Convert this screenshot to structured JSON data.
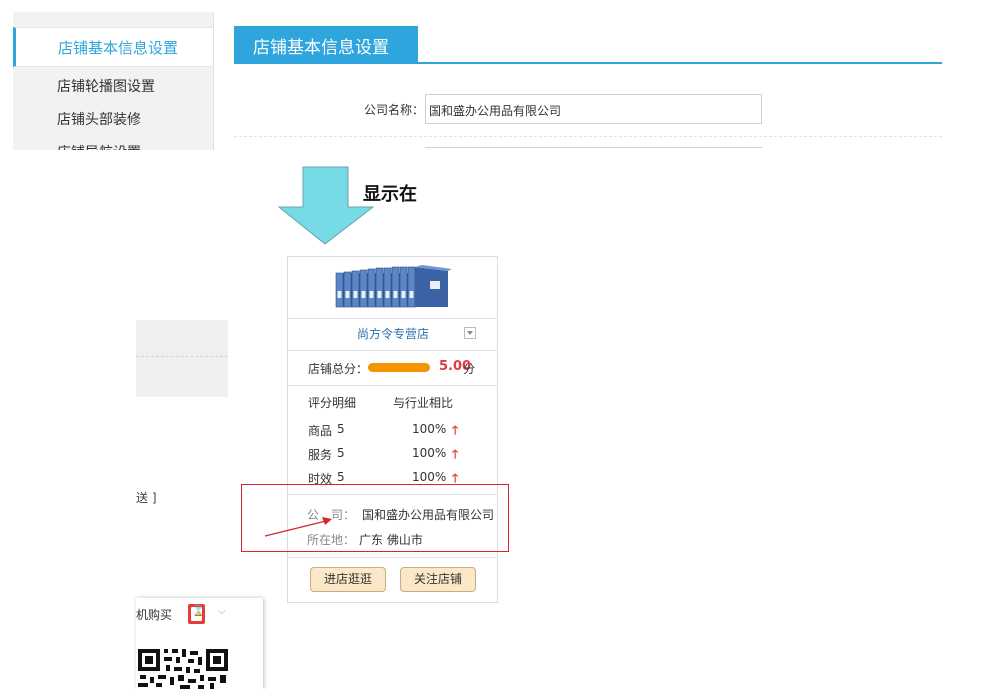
{
  "sidebar": {
    "active_label": "店铺基本信息设置",
    "items": [
      {
        "label": "店铺轮播图设置"
      },
      {
        "label": "店铺头部装修"
      },
      {
        "label": "店铺导航设置"
      }
    ]
  },
  "settings": {
    "tab_title": "店铺基本信息设置",
    "company_label": "公司名称：",
    "company_value": "国和盛办公用品有限公司"
  },
  "annotation": {
    "note": "显示在"
  },
  "fragments": {
    "partial_text": "送 ]",
    "mobile_buy": "机购买"
  },
  "store_card": {
    "shop_name": "尚方令专营店",
    "total_label": "店铺总分：",
    "total_score": "5.00",
    "score_unit": "分",
    "score_fill_fraction": 1.0,
    "detail_label": "评分明细",
    "compare_label": "与行业相比",
    "ratings": [
      {
        "name": "商品",
        "score": "5",
        "compare": "100%"
      },
      {
        "name": "服务",
        "score": "5",
        "compare": "100%"
      },
      {
        "name": "时效",
        "score": "5",
        "compare": "100%"
      }
    ],
    "company_label": "公　司：",
    "company_value": "国和盛办公用品有限公司",
    "location_label": "所在地：",
    "location_value": "广东 佛山市",
    "enter_button": "进店逛逛",
    "follow_button": "关注店铺"
  },
  "colors": {
    "accent": "#2ea6dd",
    "score_red": "#e4393c",
    "bar_orange": "#f39400",
    "annotation_red": "#d9232d",
    "arrow_fill": "#76dbe6"
  }
}
